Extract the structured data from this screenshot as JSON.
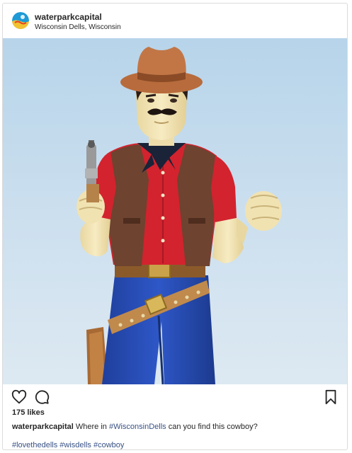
{
  "post": {
    "username": "waterparkcapital",
    "location": "Wisconsin Dells, Wisconsin",
    "likes": "175 likes",
    "caption": {
      "username": "waterparkcapital",
      "text_before": "Where in",
      "hashtag": "#WisconsinDells",
      "text_after": "can you find this cowboy?"
    },
    "hashtags": [
      "#lovethedells",
      "#wisdells",
      "#cowboy"
    ]
  },
  "icons": {
    "like": "heart-outline-icon",
    "comment": "speech-bubble-icon",
    "save": "bookmark-outline-icon",
    "avatar": "waterpark-logo"
  },
  "colors": {
    "text": "#262626",
    "hashtag": "#385185",
    "border": "#dbdbdb"
  }
}
